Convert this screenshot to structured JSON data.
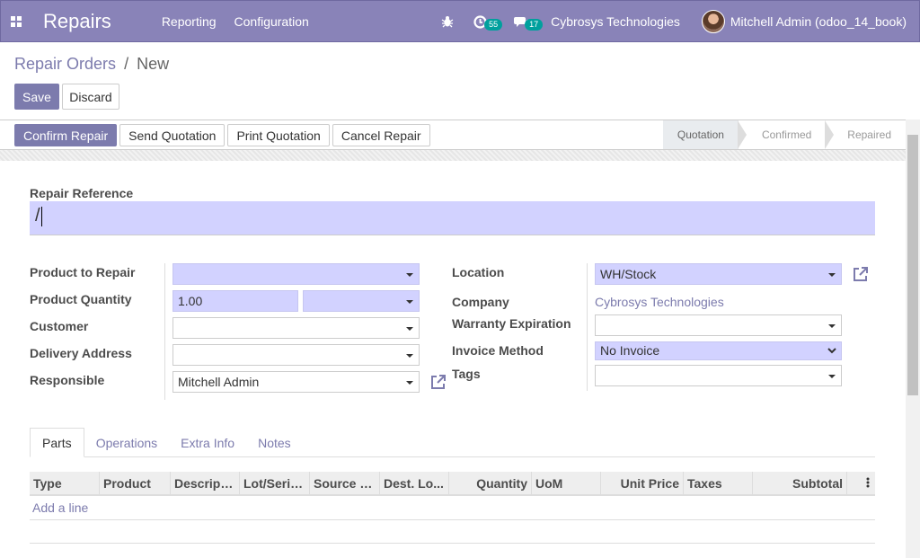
{
  "navbar": {
    "app_name": "Repairs",
    "menu": [
      "Reporting",
      "Configuration"
    ],
    "activity_count": "55",
    "message_count": "17",
    "company": "Cybrosys Technologies",
    "user": "Mitchell Admin (odoo_14_book)",
    "accent_color": "#8983b8"
  },
  "breadcrumb": {
    "parent": "Repair Orders",
    "separator": "/",
    "current": "New"
  },
  "actions": {
    "save": "Save",
    "discard": "Discard"
  },
  "status_buttons": [
    "Confirm Repair",
    "Send Quotation",
    "Print Quotation",
    "Cancel Repair"
  ],
  "stages": {
    "items": [
      "Quotation",
      "Confirmed",
      "Repaired"
    ],
    "active": "Quotation"
  },
  "form": {
    "repair_reference_label": "Repair Reference",
    "repair_reference_value": "/",
    "left": {
      "product_to_repair": {
        "label": "Product to Repair",
        "value": ""
      },
      "product_quantity": {
        "label": "Product Quantity",
        "value": "1.00",
        "uom": ""
      },
      "customer": {
        "label": "Customer",
        "value": ""
      },
      "delivery_address": {
        "label": "Delivery Address",
        "value": ""
      },
      "responsible": {
        "label": "Responsible",
        "value": "Mitchell Admin"
      }
    },
    "right": {
      "location": {
        "label": "Location",
        "value": "WH/Stock"
      },
      "company": {
        "label": "Company",
        "value": "Cybrosys Technologies"
      },
      "warranty_expiration": {
        "label": "Warranty Expiration",
        "value": ""
      },
      "invoice_method": {
        "label": "Invoice Method",
        "value": "No Invoice"
      },
      "tags": {
        "label": "Tags",
        "value": ""
      }
    }
  },
  "tabs": {
    "items": [
      "Parts",
      "Operations",
      "Extra Info",
      "Notes"
    ],
    "active": "Parts"
  },
  "parts_table": {
    "columns": [
      "Type",
      "Product",
      "Descripti...",
      "Lot/Seria...",
      "Source L...",
      "Dest. Lo...",
      "Quantity",
      "UoM",
      "Unit Price",
      "Taxes",
      "Subtotal"
    ],
    "add_line": "Add a line",
    "options_icon": "vertical-dots-icon"
  }
}
